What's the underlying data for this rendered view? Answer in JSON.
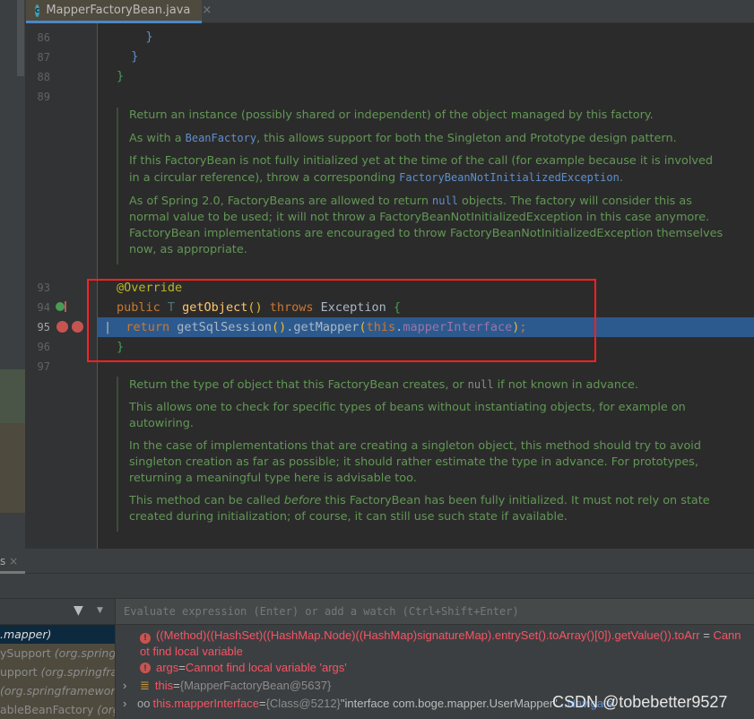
{
  "editor": {
    "tab": {
      "filename": "MapperFactoryBean.java",
      "icon": "java-class-icon"
    },
    "lines": [
      {
        "number": "86",
        "code": "    }"
      },
      {
        "number": "87",
        "code": "  }"
      },
      {
        "number": "88",
        "code": "}"
      },
      {
        "number": "89",
        "code": ""
      },
      {
        "number": "93",
        "code": "@Override"
      },
      {
        "number": "94",
        "code": "public T getObject() throws Exception {"
      },
      {
        "number": "95",
        "code": "  return getSqlSession().getMapper(this.mapperInterface);"
      },
      {
        "number": "96",
        "code": "}"
      },
      {
        "number": "97",
        "code": ""
      }
    ],
    "code94": {
      "public": "public ",
      "T": "T ",
      "method": "getObject",
      "parens": "() ",
      "throws": "throws ",
      "exc": "Exception ",
      "brace": "{"
    },
    "code95": {
      "return": "return ",
      "call": "getSqlSession",
      "p1": "()",
      "mid": ".getMapper",
      "p2": "(",
      "this": "this",
      "dot": ".",
      "field": "mapperInterface",
      "p3": ")",
      "semi": ";"
    },
    "doc1": {
      "p1": "Return an instance (possibly shared or independent) of the object managed by this factory.",
      "p2a": "As with a ",
      "p2code": "BeanFactory",
      "p2b": ", this allows support for both the Singleton and Prototype design pattern.",
      "p3a": "If this FactoryBean is not fully initialized yet at the time of the call (for example because it is involved in a circular reference), throw a corresponding ",
      "p3code": "FactoryBeanNotInitializedException",
      "p3b": ".",
      "p4a": "As of Spring 2.0, FactoryBeans are allowed to return ",
      "p4code": "null",
      "p4b": " objects. The factory will consider this as normal value to be used; it will not throw a FactoryBeanNotInitializedException in this case anymore. FactoryBean implementations are encouraged to throw FactoryBeanNotInitializedException themselves now, as appropriate."
    },
    "doc2": {
      "p1a": "Return the type of object that this FactoryBean creates, or ",
      "p1code": "null",
      "p1b": " if not known in advance.",
      "p2": "This allows one to check for specific types of beans without instantiating objects, for example on autowiring.",
      "p3": "In the case of implementations that are creating a singleton object, this method should try to avoid singleton creation as far as possible; it should rather estimate the type in advance. For prototypes, returning a meaningful type here is advisable too.",
      "p4a": "This method can be called ",
      "p4em": "before",
      "p4b": " this FactoryBean has been fully initialized. It must not rely on state created during initialization; of course, it can still use such state if available."
    }
  },
  "debug": {
    "tab_partial": "s",
    "frames": [
      {
        "name": "",
        "pkg": ".mapper)",
        "selected": true
      },
      {
        "name": "ySupport ",
        "pkg": "(org.springf"
      },
      {
        "name": "upport ",
        "pkg": "(org.springfra"
      },
      {
        "name": "",
        "pkg": "(org.springframework."
      },
      {
        "name": "ableBeanFactory ",
        "pkg": "(org.s"
      }
    ],
    "eval_placeholder": "Evaluate expression (Enter) or add a watch (Ctrl+Shift+Enter)",
    "variables": [
      {
        "name": "((Method)((HashSet)((HashMap.Node)((HashMap)signatureMap).entrySet().toArray()[0]).getValue()).toArr",
        "eq": " = ",
        "value": "Cannot find local variable",
        "icon": "error-icon"
      },
      {
        "name": "args",
        "eq": " = ",
        "value": "Cannot find local variable 'args'",
        "icon": "error-icon"
      },
      {
        "name": "this",
        "eq": " = ",
        "value": "{MapperFactoryBean@5637}",
        "icon": "object-icon"
      },
      {
        "name": "this.mapperInterface",
        "eq": " = ",
        "value": "{Class@5212}",
        "extra": " \"interface com.boge.mapper.UserMapper\"",
        "ellipsis": " ... ",
        "link": "Navigate",
        "icon": "watch-icon"
      }
    ]
  },
  "watermark": "CSDN @tobebetter9527",
  "colors": {
    "highlight": "#2d5a8e",
    "annotation_box": "#ff2020",
    "error": "#f75464",
    "doc": "#629755"
  }
}
